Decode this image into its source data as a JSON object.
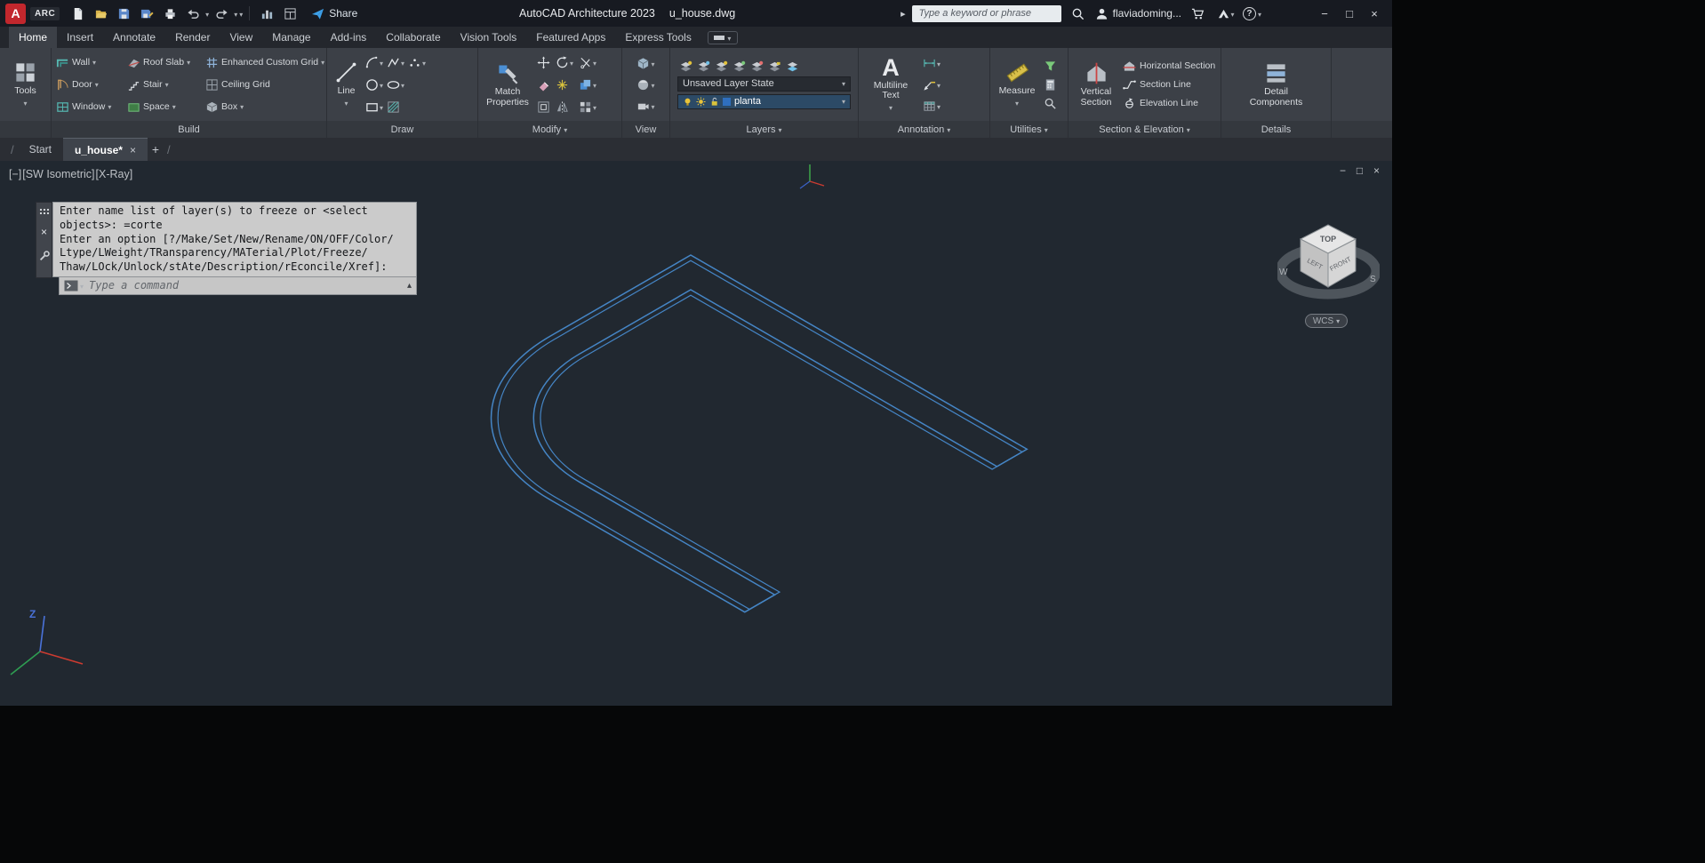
{
  "icons": {
    "caret_down": "▾",
    "caret_up": "▴",
    "slash": "/",
    "close_x": "×",
    "expand_arrow": "▸",
    "help_glyph": "?",
    "mtext_glyph": "A"
  },
  "titlebar": {
    "app_button": "A",
    "workspace": "ARC",
    "share_label": "Share",
    "app_title": "AutoCAD Architecture 2023",
    "doc_name": "u_house.dwg",
    "search_placeholder": "Type a keyword or phrase",
    "username": "flaviadoming...",
    "window": {
      "minimize": "−",
      "maximize": "□",
      "close": "×"
    }
  },
  "ribbon_tabs": {
    "items": [
      "Home",
      "Insert",
      "Annotate",
      "Render",
      "View",
      "Manage",
      "Add-ins",
      "Collaborate",
      "Vision Tools",
      "Featured Apps",
      "Express Tools"
    ],
    "active": "Home"
  },
  "panels": {
    "tools": {
      "title": "Tools"
    },
    "build": {
      "label": "Build",
      "wall": "Wall",
      "door": "Door",
      "window": "Window",
      "roof_slab": "Roof Slab",
      "stair": "Stair",
      "space": "Space",
      "enhanced_grid": "Enhanced Custom Grid",
      "ceiling_grid": "Ceiling Grid",
      "box": "Box"
    },
    "draw": {
      "label": "Draw",
      "line": "Line"
    },
    "modify": {
      "label": "Modify",
      "match_properties": "Match Properties"
    },
    "view": {
      "label": "View"
    },
    "layers": {
      "label": "Layers",
      "layer_state": "Unsaved Layer State",
      "current_layer": "planta"
    },
    "annotation": {
      "label": "Annotation",
      "multiline_text": "Multiline Text"
    },
    "utilities": {
      "label": "Utilities",
      "measure": "Measure"
    },
    "section": {
      "label": "Section & Elevation",
      "vertical_section": "Vertical Section",
      "horizontal_section": "Horizontal Section",
      "section_line": "Section Line",
      "elevation_line": "Elevation Line"
    },
    "details": {
      "label": "Details",
      "detail_components": "Detail Components"
    }
  },
  "filetabs": {
    "start": "Start",
    "active": "u_house*",
    "close": "×",
    "add": "+"
  },
  "viewport": {
    "min": "[−]",
    "view": "[SW Isometric]",
    "style": "[X-Ray]",
    "win_min": "−",
    "win_restore": "□",
    "win_close": "×"
  },
  "viewcube": {
    "top": "TOP",
    "left": "LEFT",
    "front": "FRONT",
    "west": "W",
    "south": "S",
    "wcs": "WCS"
  },
  "command": {
    "lines": [
      "Enter name list of layer(s) to freeze or <select",
      "objects>: =corte",
      "Enter an option [?/Make/Set/New/Rename/ON/OFF/Color/",
      "Ltype/LWeight/TRansparency/MATerial/Plot/Freeze/",
      "Thaw/LOck/Unlock/stAte/Description/rEconcile/Xref]:"
    ],
    "placeholder": "Type a command"
  },
  "ucs": {
    "z_label": "Z"
  },
  "drawing": {
    "accent_line_color": "#4585c5",
    "background": "#212830"
  }
}
